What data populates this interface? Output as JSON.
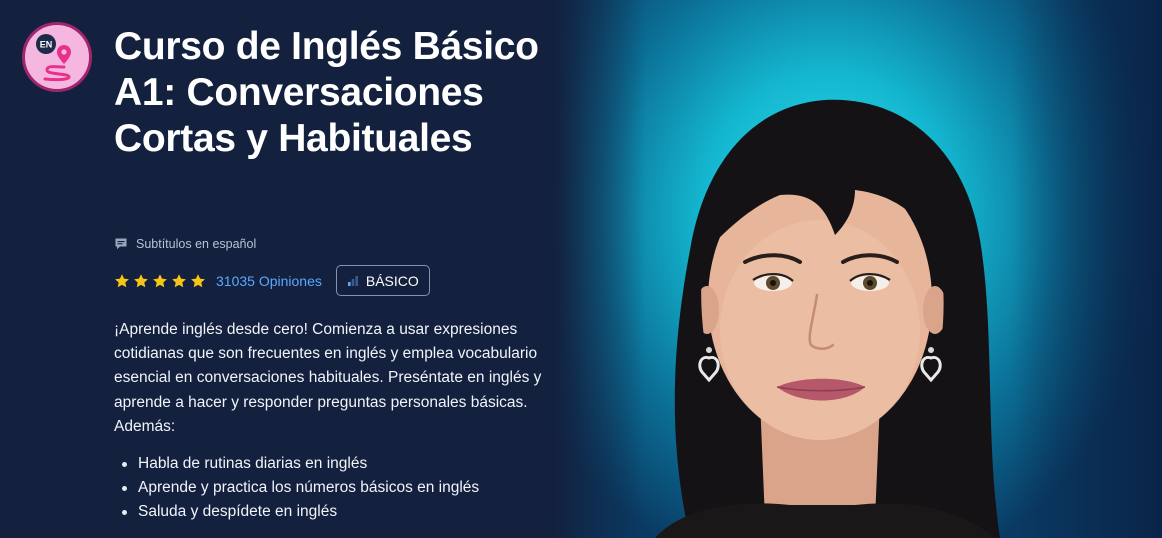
{
  "course": {
    "title": "Curso de Inglés Básico A1: Conversaciones Cortas y Habituales",
    "badge_text": "EN",
    "subtitles": "Subtítulos en español",
    "rating": 5,
    "reviews": "31035 Opiniones",
    "level": "BÁSICO",
    "description": "¡Aprende inglés desde cero! Comienza a usar expresiones cotidianas que son frecuentes en inglés y emplea vocabulario esencial en conversaciones habituales. Preséntate en inglés y aprende a hacer y responder preguntas personales básicas. Además:",
    "bullets": [
      "Habla de rutinas diarias en inglés",
      "Aprende y practica los números básicos en inglés",
      "Saluda y despídete en inglés"
    ]
  },
  "icons": {
    "badge": "location-pin-path-icon",
    "subtitles": "chat-bubble-icon",
    "star": "star-icon",
    "level": "bar-chart-icon"
  },
  "colors": {
    "background": "#13213f",
    "accent_link": "#5aa8ff",
    "star": "#f5c518",
    "badge_bg": "#f5b7e0",
    "badge_border": "#a0256f",
    "hero_teal": "#1fc6db"
  }
}
